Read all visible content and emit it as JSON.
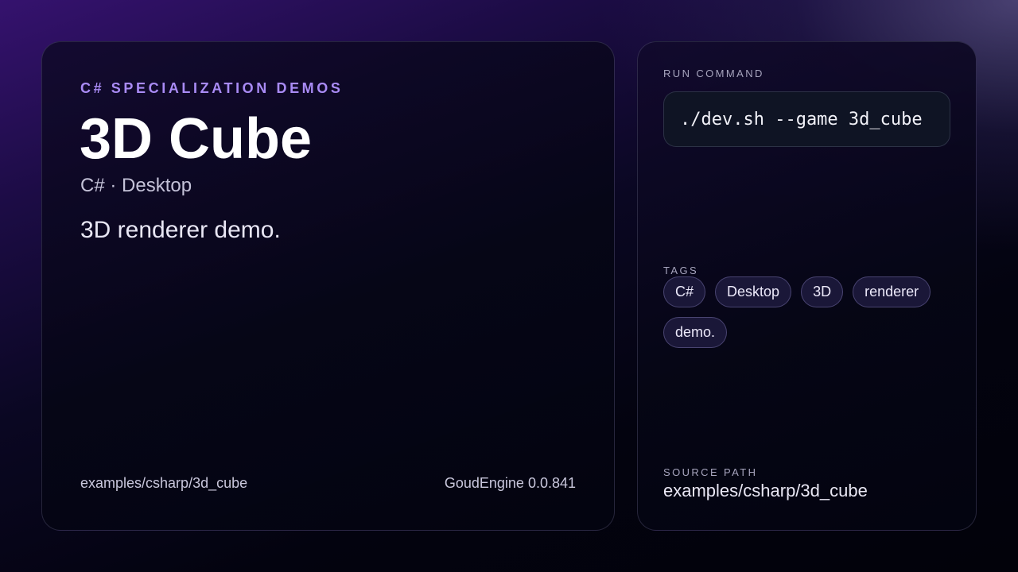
{
  "main": {
    "eyebrow": "C# SPECIALIZATION DEMOS",
    "title": "3D Cube",
    "subtitle": "C# · Desktop",
    "description": "3D renderer demo.",
    "footer_path": "examples/csharp/3d_cube",
    "footer_version": "GoudEngine 0.0.841"
  },
  "sidebar": {
    "run_label": "RUN COMMAND",
    "command": "./dev.sh --game 3d_cube",
    "tags_label": "TAGS",
    "tags": [
      "C#",
      "Desktop",
      "3D",
      "renderer",
      "demo."
    ],
    "source_label": "SOURCE PATH",
    "source_path": "examples/csharp/3d_cube"
  },
  "colors": {
    "accent": "#a98bf5",
    "tag_bg": "#1a1738",
    "command_bg": "#0f1424"
  }
}
